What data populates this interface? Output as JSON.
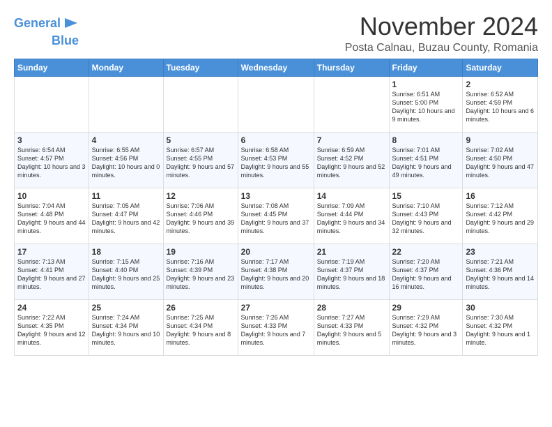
{
  "logo": {
    "line1": "General",
    "line2": "Blue"
  },
  "title": "November 2024",
  "subtitle": "Posta Calnau, Buzau County, Romania",
  "days_header": [
    "Sunday",
    "Monday",
    "Tuesday",
    "Wednesday",
    "Thursday",
    "Friday",
    "Saturday"
  ],
  "weeks": [
    [
      {
        "day": "",
        "text": ""
      },
      {
        "day": "",
        "text": ""
      },
      {
        "day": "",
        "text": ""
      },
      {
        "day": "",
        "text": ""
      },
      {
        "day": "",
        "text": ""
      },
      {
        "day": "1",
        "text": "Sunrise: 6:51 AM\nSunset: 5:00 PM\nDaylight: 10 hours and 9 minutes."
      },
      {
        "day": "2",
        "text": "Sunrise: 6:52 AM\nSunset: 4:59 PM\nDaylight: 10 hours and 6 minutes."
      }
    ],
    [
      {
        "day": "3",
        "text": "Sunrise: 6:54 AM\nSunset: 4:57 PM\nDaylight: 10 hours and 3 minutes."
      },
      {
        "day": "4",
        "text": "Sunrise: 6:55 AM\nSunset: 4:56 PM\nDaylight: 10 hours and 0 minutes."
      },
      {
        "day": "5",
        "text": "Sunrise: 6:57 AM\nSunset: 4:55 PM\nDaylight: 9 hours and 57 minutes."
      },
      {
        "day": "6",
        "text": "Sunrise: 6:58 AM\nSunset: 4:53 PM\nDaylight: 9 hours and 55 minutes."
      },
      {
        "day": "7",
        "text": "Sunrise: 6:59 AM\nSunset: 4:52 PM\nDaylight: 9 hours and 52 minutes."
      },
      {
        "day": "8",
        "text": "Sunrise: 7:01 AM\nSunset: 4:51 PM\nDaylight: 9 hours and 49 minutes."
      },
      {
        "day": "9",
        "text": "Sunrise: 7:02 AM\nSunset: 4:50 PM\nDaylight: 9 hours and 47 minutes."
      }
    ],
    [
      {
        "day": "10",
        "text": "Sunrise: 7:04 AM\nSunset: 4:48 PM\nDaylight: 9 hours and 44 minutes."
      },
      {
        "day": "11",
        "text": "Sunrise: 7:05 AM\nSunset: 4:47 PM\nDaylight: 9 hours and 42 minutes."
      },
      {
        "day": "12",
        "text": "Sunrise: 7:06 AM\nSunset: 4:46 PM\nDaylight: 9 hours and 39 minutes."
      },
      {
        "day": "13",
        "text": "Sunrise: 7:08 AM\nSunset: 4:45 PM\nDaylight: 9 hours and 37 minutes."
      },
      {
        "day": "14",
        "text": "Sunrise: 7:09 AM\nSunset: 4:44 PM\nDaylight: 9 hours and 34 minutes."
      },
      {
        "day": "15",
        "text": "Sunrise: 7:10 AM\nSunset: 4:43 PM\nDaylight: 9 hours and 32 minutes."
      },
      {
        "day": "16",
        "text": "Sunrise: 7:12 AM\nSunset: 4:42 PM\nDaylight: 9 hours and 29 minutes."
      }
    ],
    [
      {
        "day": "17",
        "text": "Sunrise: 7:13 AM\nSunset: 4:41 PM\nDaylight: 9 hours and 27 minutes."
      },
      {
        "day": "18",
        "text": "Sunrise: 7:15 AM\nSunset: 4:40 PM\nDaylight: 9 hours and 25 minutes."
      },
      {
        "day": "19",
        "text": "Sunrise: 7:16 AM\nSunset: 4:39 PM\nDaylight: 9 hours and 23 minutes."
      },
      {
        "day": "20",
        "text": "Sunrise: 7:17 AM\nSunset: 4:38 PM\nDaylight: 9 hours and 20 minutes."
      },
      {
        "day": "21",
        "text": "Sunrise: 7:19 AM\nSunset: 4:37 PM\nDaylight: 9 hours and 18 minutes."
      },
      {
        "day": "22",
        "text": "Sunrise: 7:20 AM\nSunset: 4:37 PM\nDaylight: 9 hours and 16 minutes."
      },
      {
        "day": "23",
        "text": "Sunrise: 7:21 AM\nSunset: 4:36 PM\nDaylight: 9 hours and 14 minutes."
      }
    ],
    [
      {
        "day": "24",
        "text": "Sunrise: 7:22 AM\nSunset: 4:35 PM\nDaylight: 9 hours and 12 minutes."
      },
      {
        "day": "25",
        "text": "Sunrise: 7:24 AM\nSunset: 4:34 PM\nDaylight: 9 hours and 10 minutes."
      },
      {
        "day": "26",
        "text": "Sunrise: 7:25 AM\nSunset: 4:34 PM\nDaylight: 9 hours and 8 minutes."
      },
      {
        "day": "27",
        "text": "Sunrise: 7:26 AM\nSunset: 4:33 PM\nDaylight: 9 hours and 7 minutes."
      },
      {
        "day": "28",
        "text": "Sunrise: 7:27 AM\nSunset: 4:33 PM\nDaylight: 9 hours and 5 minutes."
      },
      {
        "day": "29",
        "text": "Sunrise: 7:29 AM\nSunset: 4:32 PM\nDaylight: 9 hours and 3 minutes."
      },
      {
        "day": "30",
        "text": "Sunrise: 7:30 AM\nSunset: 4:32 PM\nDaylight: 9 hours and 1 minute."
      }
    ]
  ]
}
